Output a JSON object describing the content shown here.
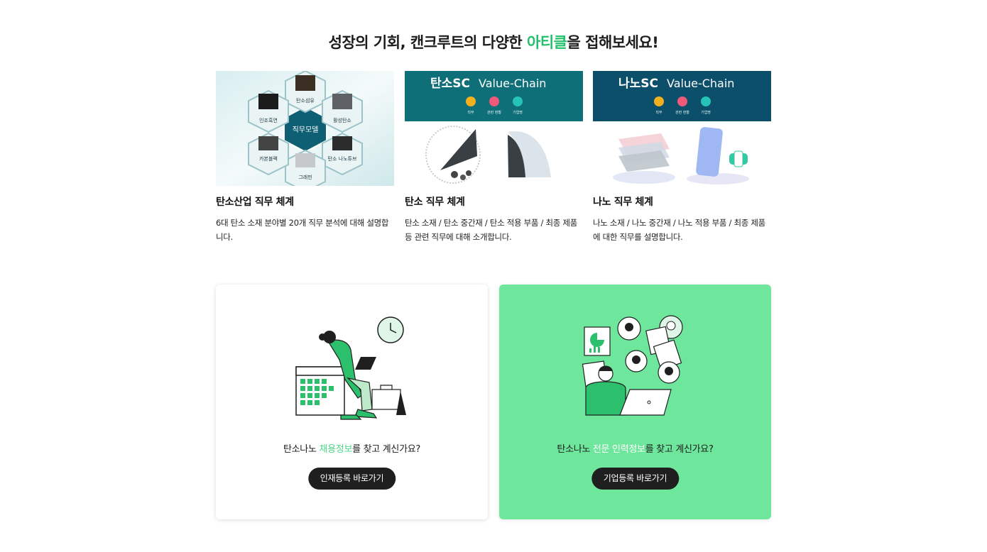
{
  "headline": {
    "before": "성장의 기회, 캔크루트의 다양한 ",
    "accent": "아티클",
    "after": "을 접해보세요!"
  },
  "colors": {
    "accent": "#22c06a",
    "panel_green": "#6ee79c",
    "banner_teal": "#0f6f79",
    "banner_navy": "#0b4f6b",
    "button_dark": "#1f1f1f"
  },
  "cards": [
    {
      "title": "탄소산업 직무 체계",
      "desc": "6대 탄소 소재 분야별 20개 직무 분석에 대해 설명합니다.",
      "thumb": {
        "center": "직무모델",
        "cells": [
          "탄소섬유",
          "활성탄소",
          "탄소\n나노튜브",
          "그래핀",
          "카본블랙",
          "인조흑연"
        ]
      }
    },
    {
      "title": "탄소 직무 체계",
      "desc": "탄소 소재 / 탄소 중간재 / 탄소 적용 부품 / 최종 제품 등 관련 직무에 대해 소개합니다.",
      "thumb": {
        "banner_bold": "탄소SC",
        "banner_text": "Value-Chain",
        "badges": [
          "직무",
          "관련 현황",
          "기업명"
        ]
      }
    },
    {
      "title": "나노 직무 체계",
      "desc": "나노 소재 / 나노 중간재 / 나노 적용 부품 / 최종 제품에 대한 직무를 설명합니다.",
      "thumb": {
        "banner_bold": "나노SC",
        "banner_text": "Value-Chain",
        "badges": [
          "직무",
          "관련 현황",
          "기업명"
        ]
      }
    }
  ],
  "panels": {
    "left": {
      "before": "탄소나노 ",
      "highlight": "채용정보",
      "after": "를 찾고 계신가요?",
      "button": "인재등록 바로가기",
      "illustration": "person-laptop-calendar-icon"
    },
    "right": {
      "before": "탄소나노 ",
      "highlight": "전문 인력정보",
      "after": "를 찾고 계신가요?",
      "button": "기업등록 바로가기",
      "illustration": "person-network-profiles-icon"
    }
  }
}
